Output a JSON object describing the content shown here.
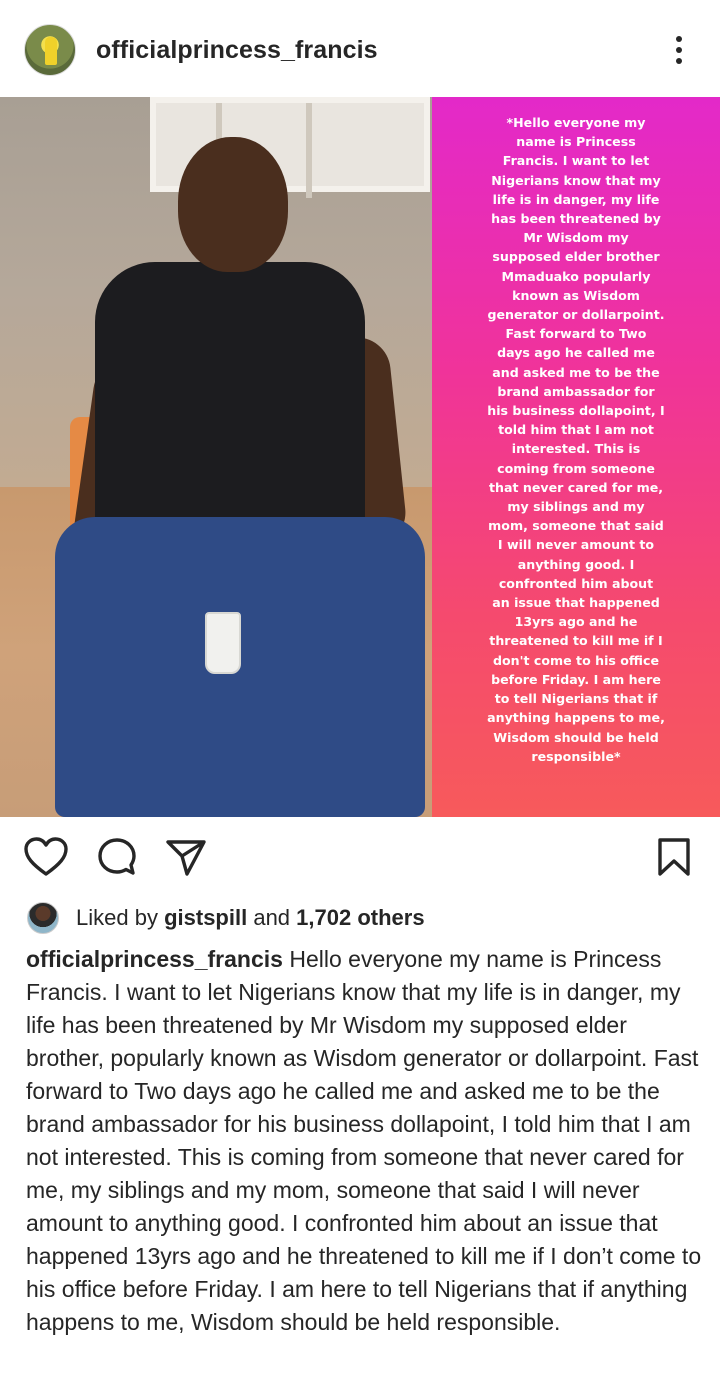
{
  "post": {
    "username": "officialprincess_francis",
    "more_icon": "more-vertical-icon"
  },
  "story_text": "*Hello everyone my\nname is Princess\nFrancis. I want to let\nNigerians know that my\nlife is in danger, my life\nhas been threatened by\nMr Wisdom my\nsupposed elder brother\nMmaduako popularly\nknown as Wisdom\ngenerator or dollarpoint.\nFast forward to Two\ndays ago he called me\nand asked me to be the\nbrand ambassador for\nhis business dollapoint, I\ntold him that I am not\ninterested. This is\ncoming from someone\nthat never cared for me,\nmy siblings and my\nmom, someone that said\nI will never amount to\nanything good. I\nconfronted him about\nan issue that happened\n13yrs ago and he\nthreatened to kill me if I\ndon't come to his office\nbefore Friday. I am here\nto tell Nigerians that if\nanything happens to me,\nWisdom should be held\nresponsible*",
  "actions": {
    "like_icon": "heart-icon",
    "comment_icon": "comment-icon",
    "share_icon": "send-icon",
    "save_icon": "bookmark-icon"
  },
  "likes": {
    "prefix": "Liked by",
    "user": "gistspill",
    "middle": "and",
    "others": "1,702 others"
  },
  "caption": {
    "username": "officialprincess_francis",
    "text": "Hello everyone my name is Princess Francis. I want to let Nigerians know that my life is in danger, my life has been threatened by Mr Wisdom my supposed elder brother, popularly known as Wisdom generator or dollarpoint. Fast forward to Two days ago he called me and asked me to be the brand ambassador for his business dollapoint, I told him that I am not interested. This is coming from someone that never cared for me, my siblings and my mom, someone that said I will never amount to anything good. I confronted him about an issue that happened 13yrs ago and he threatened to kill me if I don’t come to his office before Friday. I am here to tell Nigerians that if anything happens to me, Wisdom should be held responsible."
  },
  "colors": {
    "panel_top": "#e329c9",
    "panel_bottom": "#f75a5b",
    "text": "#262626"
  }
}
